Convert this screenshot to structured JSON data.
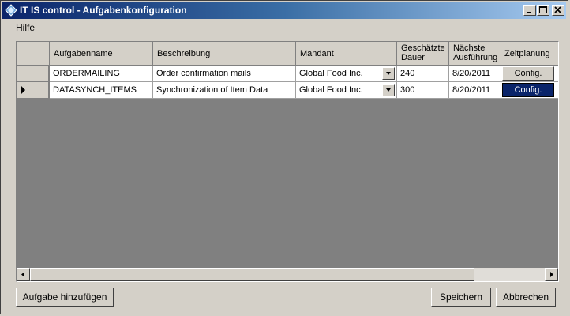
{
  "window": {
    "title": "IT IS control - Aufgabenkonfiguration"
  },
  "menu": {
    "items": [
      {
        "label": "Hilfe"
      }
    ]
  },
  "grid": {
    "columns": [
      {
        "label": "Aufgabenname"
      },
      {
        "label": "Beschreibung"
      },
      {
        "label": "Mandant"
      },
      {
        "label": "Geschätzte Dauer"
      },
      {
        "label": "Nächste Ausführung"
      },
      {
        "label": "Zeitplanung"
      }
    ],
    "rows": [
      {
        "name": "ORDERMAILING",
        "description": "Order confirmation mails",
        "client": "Global Food Inc.",
        "duration": "240",
        "next_run": "8/20/2011",
        "schedule_label": "Config.",
        "current": false
      },
      {
        "name": "DATASYNCH_ITEMS",
        "description": "Synchronization of Item Data",
        "client": "Global Food Inc.",
        "duration": "300",
        "next_run": "8/20/2011",
        "schedule_label": "Config.",
        "current": true
      }
    ]
  },
  "footer": {
    "add_label": "Aufgabe hinzufügen",
    "save_label": "Speichern",
    "cancel_label": "Abbrechen"
  },
  "icons": {
    "app": "app-diamond-icon",
    "minimize": "minimize-icon",
    "maximize": "maximize-icon",
    "close": "close-icon",
    "row_pointer": "row-pointer-icon",
    "dropdown": "chevron-down-icon",
    "scroll_left": "arrow-left-icon",
    "scroll_right": "arrow-right-icon"
  },
  "colors": {
    "title_start": "#0a246a",
    "title_end": "#a6caf0",
    "selection": "#0a246a",
    "surface": "#d4d0c8",
    "grid_bg": "#808080"
  }
}
